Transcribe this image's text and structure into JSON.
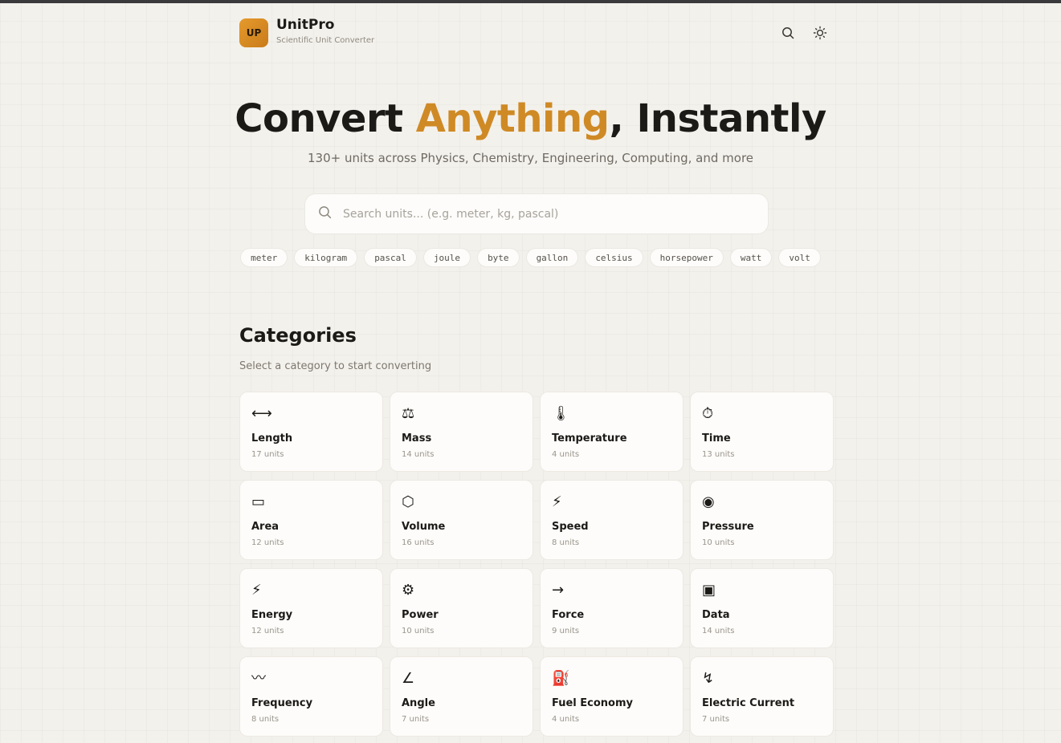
{
  "header": {
    "logo_text": "UP",
    "brand_name": "UnitPro",
    "brand_subtitle": "Scientific Unit Converter"
  },
  "hero": {
    "title_prefix": "Convert ",
    "title_accent": "Anything",
    "title_suffix": ", Instantly",
    "subtitle": "130+ units across Physics, Chemistry, Engineering, Computing, and more"
  },
  "search": {
    "placeholder": "Search units... (e.g. meter, kg, pascal)"
  },
  "chips": [
    "meter",
    "kilogram",
    "pascal",
    "joule",
    "byte",
    "gallon",
    "celsius",
    "horsepower",
    "watt",
    "volt"
  ],
  "categories": {
    "title": "Categories",
    "subtitle": "Select a category to start converting",
    "items": [
      {
        "icon": "⟷",
        "name": "Length",
        "count": "17 units"
      },
      {
        "icon": "⚖",
        "name": "Mass",
        "count": "14 units"
      },
      {
        "icon": "🌡",
        "name": "Temperature",
        "count": "4 units"
      },
      {
        "icon": "⏱",
        "name": "Time",
        "count": "13 units"
      },
      {
        "icon": "▭",
        "name": "Area",
        "count": "12 units"
      },
      {
        "icon": "⬡",
        "name": "Volume",
        "count": "16 units"
      },
      {
        "icon": "⚡",
        "name": "Speed",
        "count": "8 units"
      },
      {
        "icon": "◉",
        "name": "Pressure",
        "count": "10 units"
      },
      {
        "icon": "⚡",
        "name": "Energy",
        "count": "12 units"
      },
      {
        "icon": "⚙",
        "name": "Power",
        "count": "10 units"
      },
      {
        "icon": "→",
        "name": "Force",
        "count": "9 units"
      },
      {
        "icon": "▣",
        "name": "Data",
        "count": "14 units"
      },
      {
        "icon": "〰",
        "name": "Frequency",
        "count": "8 units"
      },
      {
        "icon": "∠",
        "name": "Angle",
        "count": "7 units"
      },
      {
        "icon": "⛽",
        "name": "Fuel Economy",
        "count": "4 units"
      },
      {
        "icon": "↯",
        "name": "Electric Current",
        "count": "7 units"
      }
    ]
  }
}
